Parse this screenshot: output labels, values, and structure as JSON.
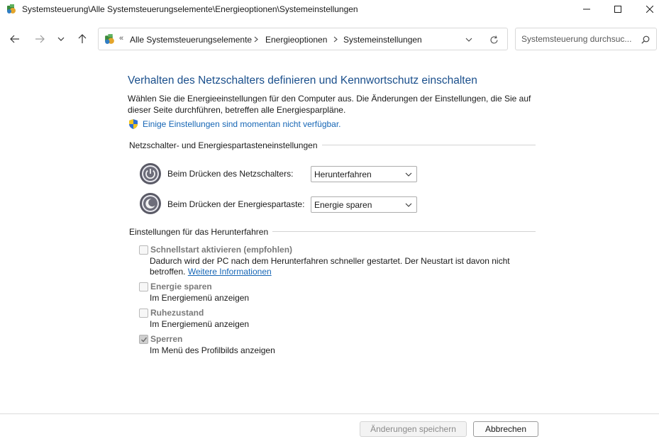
{
  "window": {
    "title": "Systemsteuerung\\Alle Systemsteuerungselemente\\Energieoptionen\\Systemeinstellungen"
  },
  "nav": {
    "back_icon": "arrow-left-icon",
    "forward_icon": "arrow-right-icon",
    "recent_icon": "chevron-down-icon",
    "up_icon": "arrow-up-icon",
    "address": {
      "overflow": "«",
      "crumbs": [
        "Alle Systemsteuerungselemente",
        "Energieoptionen",
        "Systemeinstellungen"
      ]
    },
    "search_placeholder": "Systemsteuerung durchsuc..."
  },
  "main": {
    "title": "Verhalten des Netzschalters definieren und Kennwortschutz einschalten",
    "description": "Wählen Sie die Energieeinstellungen für den Computer aus. Die Änderungen der Einstellungen, die Sie auf dieser Seite durchführen, betreffen alle Energiesparpläne.",
    "unavailable_link": "Einige Einstellungen sind momentan nicht verfügbar.",
    "power_group": {
      "heading": "Netzschalter- und Energiespartasteneinstellungen",
      "settings": [
        {
          "label": "Beim Drücken des Netzschalters:",
          "value": "Herunterfahren",
          "icon": "power-button-icon"
        },
        {
          "label": "Beim Drücken der Energiespartaste:",
          "value": "Energie sparen",
          "icon": "sleep-button-icon"
        }
      ]
    },
    "shutdown_group": {
      "heading": "Einstellungen für das Herunterfahren",
      "options": [
        {
          "title": "Schnellstart aktivieren (empfohlen)",
          "desc": "Dadurch wird der PC nach dem Herunterfahren schneller gestartet. Der Neustart ist davon nicht betroffen.",
          "more": "Weitere Informationen",
          "checked": false
        },
        {
          "title": "Energie sparen",
          "desc": "Im Energiemenü anzeigen",
          "checked": false
        },
        {
          "title": "Ruhezustand",
          "desc": "Im Energiemenü anzeigen",
          "checked": false
        },
        {
          "title": "Sperren",
          "desc": "Im Menü des Profilbilds anzeigen",
          "checked": true
        }
      ]
    }
  },
  "footer": {
    "save_label": "Änderungen speichern",
    "cancel_label": "Abbrechen"
  },
  "colors": {
    "title": "#1a4f8c",
    "link": "#1666b5"
  }
}
